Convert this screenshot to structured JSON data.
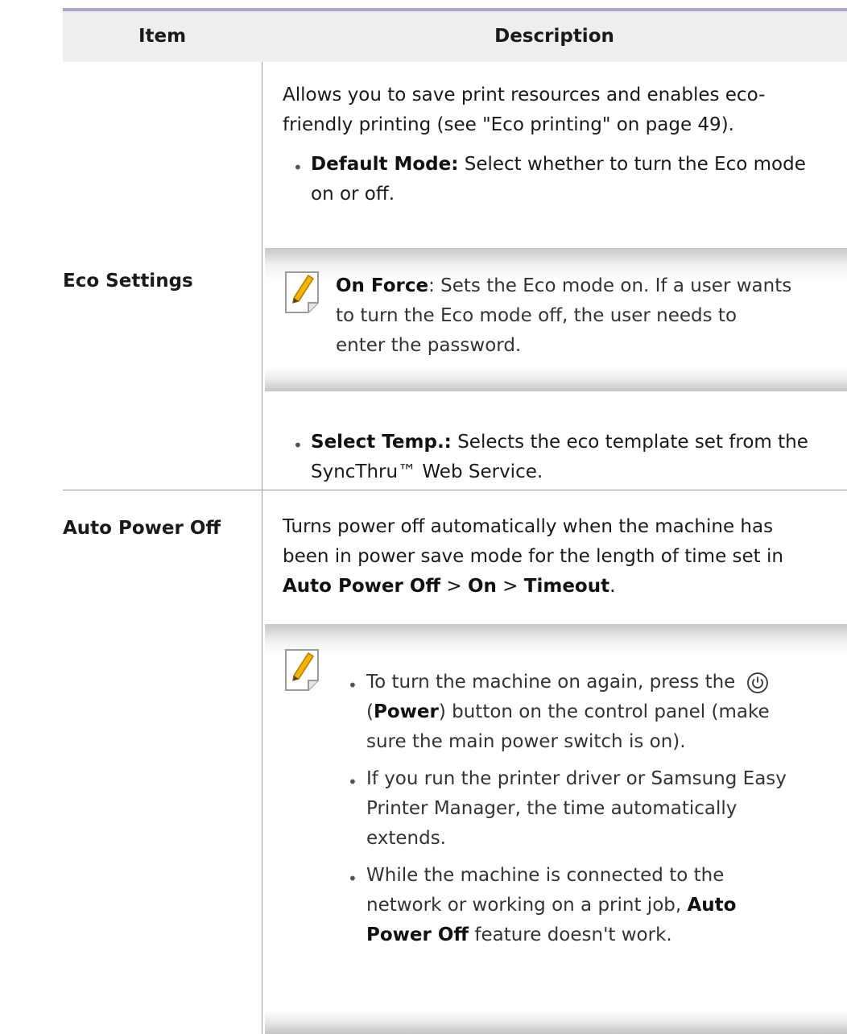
{
  "header": {
    "item": "Item",
    "description": "Description"
  },
  "eco": {
    "label": "Eco Settings",
    "intro1": "Allows you to save print resources and enables eco-",
    "intro2": "friendly printing (see \"Eco printing\" on page 49).",
    "default_mode_label": "Default Mode:",
    "default_mode_text1": "Select whether to turn the Eco mode",
    "default_mode_text2": "on or off.",
    "note_label": "On Force",
    "note_text1": ": Sets the Eco mode on. If a user wants",
    "note_text2": "to turn the Eco mode off, the user needs to",
    "note_text3": "enter the password.",
    "select_temp_label": "Select Temp.:",
    "select_temp_text1": "Selects the eco template set from the",
    "select_temp_text2": "SyncThru™ Web Service."
  },
  "auto_power": {
    "label": "Auto Power Off",
    "desc1": "Turns power off automatically when the machine has",
    "desc2": "been in power save mode for the length of time set in",
    "path_a": "Auto Power Off",
    "sep1": " > ",
    "path_b": "On",
    "sep2": " > ",
    "path_c": "Timeout",
    "path_end": ".",
    "n1_line1": "To turn the machine on again, press the",
    "n1_open": "(",
    "n1_power": "Power",
    "n1_rest": ") button on the control panel (make",
    "n1_line3": "sure the main power switch is on).",
    "n2_line1": "If you run the printer driver or Samsung Easy",
    "n2_line2": "Printer Manager, the time automatically",
    "n2_line3": "extends.",
    "n3_line1": "While the machine is connected to the",
    "n3_line2a": "network or working on a print job, ",
    "n3_bold1": "Auto",
    "n3_bold2": "Power Off",
    "n3_line3": " feature doesn't work."
  },
  "bullet_char": "•",
  "icons": [
    "note-pencil-icon",
    "power-icon"
  ]
}
